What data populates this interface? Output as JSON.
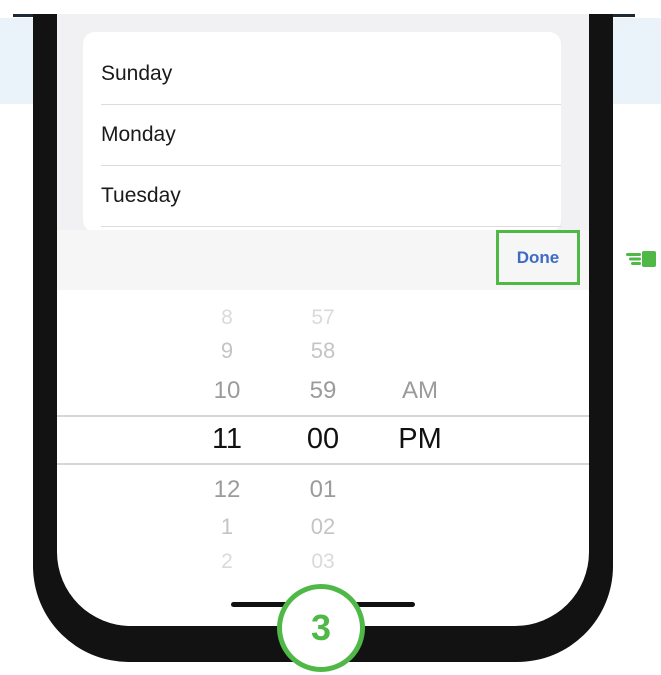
{
  "days_list": {
    "items": [
      "Sunday",
      "Monday",
      "Tuesday"
    ]
  },
  "toolbar": {
    "done_label": "Done"
  },
  "time_picker": {
    "hours": [
      "8",
      "9",
      "10",
      "11",
      "12",
      "1",
      "2"
    ],
    "minutes": [
      "57",
      "58",
      "59",
      "00",
      "01",
      "02",
      "03"
    ],
    "periods": [
      "AM",
      "PM"
    ],
    "selected": {
      "hour": "11",
      "minute": "00",
      "period": "PM"
    }
  },
  "step_badge": {
    "label": "3"
  },
  "icons": {
    "hand_pointer": "pointing-hand-icon"
  },
  "colors": {
    "highlight_green": "#4fb847",
    "done_text_blue": "#3e6bc5",
    "page_band": "#eaf3f9",
    "phone_frame": "#121212"
  }
}
